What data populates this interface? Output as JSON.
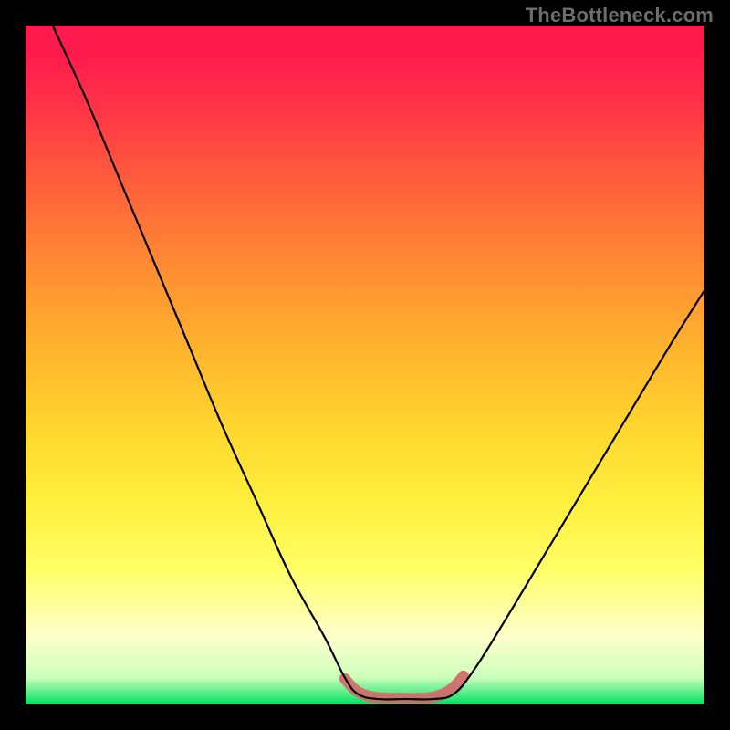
{
  "watermark": {
    "text": "TheBottleneck.com"
  },
  "chart_data": {
    "type": "line",
    "title": "",
    "xlabel": "",
    "ylabel": "",
    "x_range": [
      0,
      100
    ],
    "y_range": [
      0,
      100
    ],
    "grid": false,
    "legend": false,
    "series": [
      {
        "name": "bottleneck-curve",
        "comment": "Asymmetric V-shaped black curve; left arm starts near top and descends convexly to a flat valley at the bottom; right arm rises roughly linearly to about 60% height at the right edge.",
        "points": [
          {
            "x": 4,
            "y": 100
          },
          {
            "x": 9,
            "y": 89
          },
          {
            "x": 14,
            "y": 77
          },
          {
            "x": 19,
            "y": 65
          },
          {
            "x": 24,
            "y": 53
          },
          {
            "x": 29,
            "y": 41
          },
          {
            "x": 34,
            "y": 30
          },
          {
            "x": 39,
            "y": 19
          },
          {
            "x": 44,
            "y": 10
          },
          {
            "x": 47,
            "y": 4
          },
          {
            "x": 49,
            "y": 1.5
          },
          {
            "x": 52,
            "y": 0.8
          },
          {
            "x": 56,
            "y": 0.8
          },
          {
            "x": 60,
            "y": 0.8
          },
          {
            "x": 63,
            "y": 1.5
          },
          {
            "x": 66,
            "y": 5
          },
          {
            "x": 71,
            "y": 13
          },
          {
            "x": 77,
            "y": 23
          },
          {
            "x": 83,
            "y": 33
          },
          {
            "x": 89,
            "y": 43
          },
          {
            "x": 95,
            "y": 53
          },
          {
            "x": 100,
            "y": 61
          }
        ]
      },
      {
        "name": "valley-marker",
        "comment": "Thick muted-red fuzzy segment laid along the valley near the bottom.",
        "color": "#d36a6a",
        "points": [
          {
            "x": 47,
            "y": 3.8
          },
          {
            "x": 48.5,
            "y": 2.2
          },
          {
            "x": 50,
            "y": 1.4
          },
          {
            "x": 52,
            "y": 1.0
          },
          {
            "x": 55,
            "y": 0.9
          },
          {
            "x": 58,
            "y": 0.9
          },
          {
            "x": 60,
            "y": 1.1
          },
          {
            "x": 62,
            "y": 1.8
          },
          {
            "x": 63.5,
            "y": 3.0
          },
          {
            "x": 64.5,
            "y": 4.2
          }
        ]
      }
    ],
    "background_gradient": {
      "orientation": "vertical",
      "stops": [
        {
          "pos": 0.0,
          "color": "#ff1a4d"
        },
        {
          "pos": 0.35,
          "color": "#ff8a33"
        },
        {
          "pos": 0.6,
          "color": "#ffd82e"
        },
        {
          "pos": 0.8,
          "color": "#ffff66"
        },
        {
          "pos": 1.0,
          "color": "#00e060"
        }
      ]
    }
  }
}
